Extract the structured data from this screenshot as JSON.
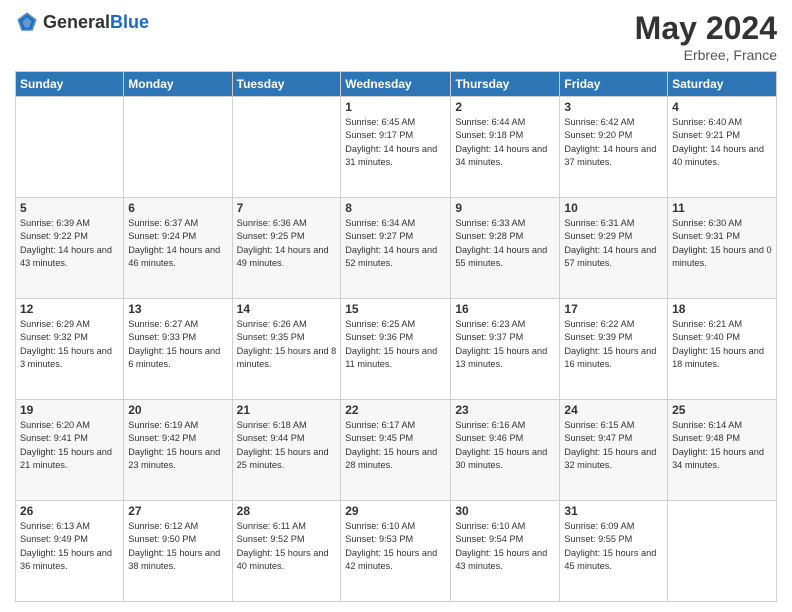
{
  "header": {
    "logo_general": "General",
    "logo_blue": "Blue",
    "month_year": "May 2024",
    "location": "Erbree, France"
  },
  "days_of_week": [
    "Sunday",
    "Monday",
    "Tuesday",
    "Wednesday",
    "Thursday",
    "Friday",
    "Saturday"
  ],
  "weeks": [
    [
      {
        "day": "",
        "sunrise": "",
        "sunset": "",
        "daylight": ""
      },
      {
        "day": "",
        "sunrise": "",
        "sunset": "",
        "daylight": ""
      },
      {
        "day": "",
        "sunrise": "",
        "sunset": "",
        "daylight": ""
      },
      {
        "day": "1",
        "sunrise": "Sunrise: 6:45 AM",
        "sunset": "Sunset: 9:17 PM",
        "daylight": "Daylight: 14 hours and 31 minutes."
      },
      {
        "day": "2",
        "sunrise": "Sunrise: 6:44 AM",
        "sunset": "Sunset: 9:18 PM",
        "daylight": "Daylight: 14 hours and 34 minutes."
      },
      {
        "day": "3",
        "sunrise": "Sunrise: 6:42 AM",
        "sunset": "Sunset: 9:20 PM",
        "daylight": "Daylight: 14 hours and 37 minutes."
      },
      {
        "day": "4",
        "sunrise": "Sunrise: 6:40 AM",
        "sunset": "Sunset: 9:21 PM",
        "daylight": "Daylight: 14 hours and 40 minutes."
      }
    ],
    [
      {
        "day": "5",
        "sunrise": "Sunrise: 6:39 AM",
        "sunset": "Sunset: 9:22 PM",
        "daylight": "Daylight: 14 hours and 43 minutes."
      },
      {
        "day": "6",
        "sunrise": "Sunrise: 6:37 AM",
        "sunset": "Sunset: 9:24 PM",
        "daylight": "Daylight: 14 hours and 46 minutes."
      },
      {
        "day": "7",
        "sunrise": "Sunrise: 6:36 AM",
        "sunset": "Sunset: 9:25 PM",
        "daylight": "Daylight: 14 hours and 49 minutes."
      },
      {
        "day": "8",
        "sunrise": "Sunrise: 6:34 AM",
        "sunset": "Sunset: 9:27 PM",
        "daylight": "Daylight: 14 hours and 52 minutes."
      },
      {
        "day": "9",
        "sunrise": "Sunrise: 6:33 AM",
        "sunset": "Sunset: 9:28 PM",
        "daylight": "Daylight: 14 hours and 55 minutes."
      },
      {
        "day": "10",
        "sunrise": "Sunrise: 6:31 AM",
        "sunset": "Sunset: 9:29 PM",
        "daylight": "Daylight: 14 hours and 57 minutes."
      },
      {
        "day": "11",
        "sunrise": "Sunrise: 6:30 AM",
        "sunset": "Sunset: 9:31 PM",
        "daylight": "Daylight: 15 hours and 0 minutes."
      }
    ],
    [
      {
        "day": "12",
        "sunrise": "Sunrise: 6:29 AM",
        "sunset": "Sunset: 9:32 PM",
        "daylight": "Daylight: 15 hours and 3 minutes."
      },
      {
        "day": "13",
        "sunrise": "Sunrise: 6:27 AM",
        "sunset": "Sunset: 9:33 PM",
        "daylight": "Daylight: 15 hours and 6 minutes."
      },
      {
        "day": "14",
        "sunrise": "Sunrise: 6:26 AM",
        "sunset": "Sunset: 9:35 PM",
        "daylight": "Daylight: 15 hours and 8 minutes."
      },
      {
        "day": "15",
        "sunrise": "Sunrise: 6:25 AM",
        "sunset": "Sunset: 9:36 PM",
        "daylight": "Daylight: 15 hours and 11 minutes."
      },
      {
        "day": "16",
        "sunrise": "Sunrise: 6:23 AM",
        "sunset": "Sunset: 9:37 PM",
        "daylight": "Daylight: 15 hours and 13 minutes."
      },
      {
        "day": "17",
        "sunrise": "Sunrise: 6:22 AM",
        "sunset": "Sunset: 9:39 PM",
        "daylight": "Daylight: 15 hours and 16 minutes."
      },
      {
        "day": "18",
        "sunrise": "Sunrise: 6:21 AM",
        "sunset": "Sunset: 9:40 PM",
        "daylight": "Daylight: 15 hours and 18 minutes."
      }
    ],
    [
      {
        "day": "19",
        "sunrise": "Sunrise: 6:20 AM",
        "sunset": "Sunset: 9:41 PM",
        "daylight": "Daylight: 15 hours and 21 minutes."
      },
      {
        "day": "20",
        "sunrise": "Sunrise: 6:19 AM",
        "sunset": "Sunset: 9:42 PM",
        "daylight": "Daylight: 15 hours and 23 minutes."
      },
      {
        "day": "21",
        "sunrise": "Sunrise: 6:18 AM",
        "sunset": "Sunset: 9:44 PM",
        "daylight": "Daylight: 15 hours and 25 minutes."
      },
      {
        "day": "22",
        "sunrise": "Sunrise: 6:17 AM",
        "sunset": "Sunset: 9:45 PM",
        "daylight": "Daylight: 15 hours and 28 minutes."
      },
      {
        "day": "23",
        "sunrise": "Sunrise: 6:16 AM",
        "sunset": "Sunset: 9:46 PM",
        "daylight": "Daylight: 15 hours and 30 minutes."
      },
      {
        "day": "24",
        "sunrise": "Sunrise: 6:15 AM",
        "sunset": "Sunset: 9:47 PM",
        "daylight": "Daylight: 15 hours and 32 minutes."
      },
      {
        "day": "25",
        "sunrise": "Sunrise: 6:14 AM",
        "sunset": "Sunset: 9:48 PM",
        "daylight": "Daylight: 15 hours and 34 minutes."
      }
    ],
    [
      {
        "day": "26",
        "sunrise": "Sunrise: 6:13 AM",
        "sunset": "Sunset: 9:49 PM",
        "daylight": "Daylight: 15 hours and 36 minutes."
      },
      {
        "day": "27",
        "sunrise": "Sunrise: 6:12 AM",
        "sunset": "Sunset: 9:50 PM",
        "daylight": "Daylight: 15 hours and 38 minutes."
      },
      {
        "day": "28",
        "sunrise": "Sunrise: 6:11 AM",
        "sunset": "Sunset: 9:52 PM",
        "daylight": "Daylight: 15 hours and 40 minutes."
      },
      {
        "day": "29",
        "sunrise": "Sunrise: 6:10 AM",
        "sunset": "Sunset: 9:53 PM",
        "daylight": "Daylight: 15 hours and 42 minutes."
      },
      {
        "day": "30",
        "sunrise": "Sunrise: 6:10 AM",
        "sunset": "Sunset: 9:54 PM",
        "daylight": "Daylight: 15 hours and 43 minutes."
      },
      {
        "day": "31",
        "sunrise": "Sunrise: 6:09 AM",
        "sunset": "Sunset: 9:55 PM",
        "daylight": "Daylight: 15 hours and 45 minutes."
      },
      {
        "day": "",
        "sunrise": "",
        "sunset": "",
        "daylight": ""
      }
    ]
  ]
}
